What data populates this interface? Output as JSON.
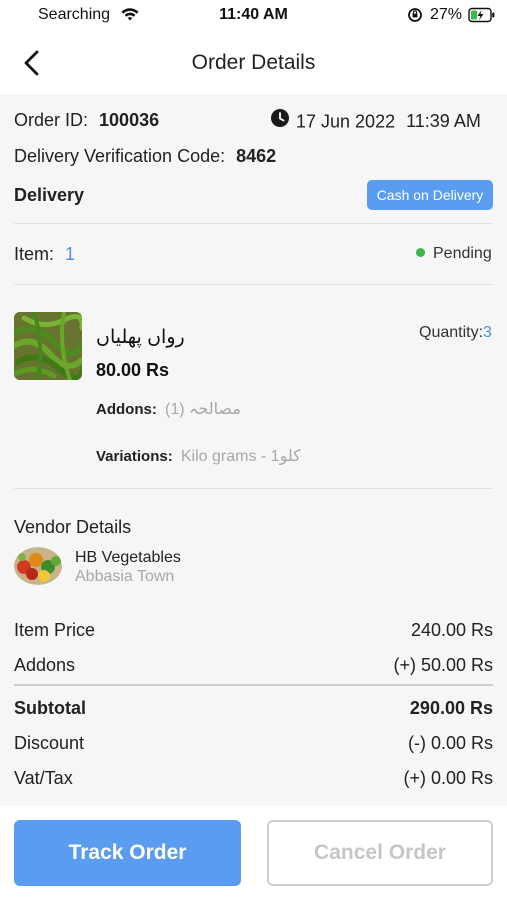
{
  "status_bar": {
    "carrier": "Searching",
    "time": "11:40 AM",
    "battery_pct": "27%"
  },
  "header": {
    "title": "Order Details"
  },
  "order": {
    "id_label": "Order ID:",
    "id_value": "100036",
    "date": "17 Jun 2022",
    "time": "11:39 AM",
    "verification_label": "Delivery Verification Code:",
    "verification_value": "8462",
    "delivery_label": "Delivery",
    "payment_method": "Cash on Delivery",
    "item_label": "Item:",
    "item_count": "1",
    "status": "Pending"
  },
  "item": {
    "name": "رواں پھلیاں",
    "price": "80.00 Rs",
    "quantity_label": "Quantity:",
    "quantity_value": "3",
    "addons_label": "Addons:",
    "addons_value": "مصالحہ (1)",
    "variations_label": "Variations:",
    "variations_value": "Kilo grams - 1کلو"
  },
  "vendor": {
    "section_title": "Vendor Details",
    "name": "HB Vegetables",
    "location": "Abbasia Town"
  },
  "summary": {
    "item_price_label": "Item Price",
    "item_price_value": "240.00 Rs",
    "addons_label": "Addons",
    "addons_value": "(+) 50.00 Rs",
    "subtotal_label": "Subtotal",
    "subtotal_value": "290.00 Rs",
    "discount_label": "Discount",
    "discount_value": "(-) 0.00 Rs",
    "vat_label": "Vat/Tax",
    "vat_value": "(+) 0.00 Rs"
  },
  "actions": {
    "track_label": "Track Order",
    "cancel_label": "Cancel Order"
  },
  "colors": {
    "accent": "#5a9cf0",
    "pending": "#3cb84a",
    "panel": "#f6f6f6"
  }
}
